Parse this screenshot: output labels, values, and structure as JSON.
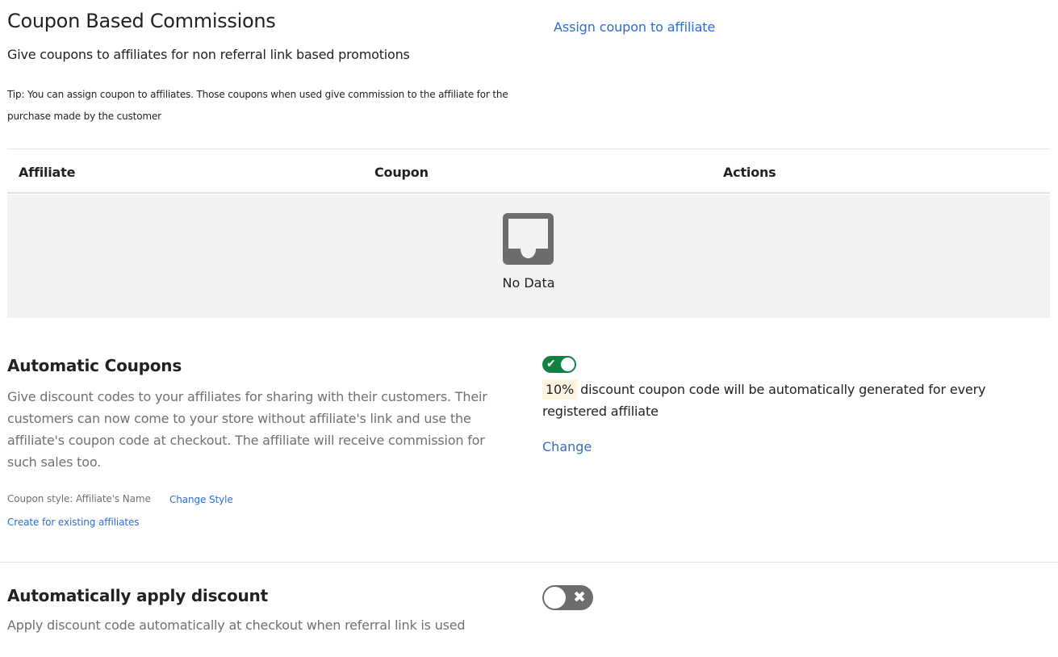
{
  "coupon_commissions": {
    "title": "Coupon Based Commissions",
    "subtitle": "Give coupons to affiliates for non referral link based promotions",
    "tip": "Tip: You can assign coupon to affiliates. Those coupons when used give commission to the affiliate for the purchase made by the customer",
    "assign_link": "Assign coupon to affiliate"
  },
  "table": {
    "columns": [
      "Affiliate",
      "Coupon",
      "Actions"
    ],
    "empty_icon": "inbox-icon",
    "empty_text": "No Data"
  },
  "automatic_coupons": {
    "title": "Automatic Coupons",
    "description": "Give discount codes to your affiliates for sharing with their customers. Their customers can now come to your store without affiliate's link and use the affiliate's coupon code at checkout. The affiliate will receive commission for such sales too.",
    "coupon_style_label": "Coupon style: Affiliate's Name",
    "change_style": "Change Style",
    "create_existing": "Create for existing affiliates",
    "toggle_on": true,
    "toggle_icon": "check-icon",
    "discount_percent": "10%",
    "info_text": "discount coupon code will be automatically generated for every registered affiliate",
    "change_link": "Change"
  },
  "auto_apply": {
    "title": "Automatically apply discount",
    "description": "Apply discount code automatically at checkout when referral link is used",
    "toggle_on": false,
    "toggle_icon": "x-icon"
  },
  "colors": {
    "link": "#2c6ecb",
    "toggle_on": "#108043",
    "toggle_off": "#6d6d6d",
    "empty_bg": "#f2f2f2",
    "badge_bg": "#fdf3e1"
  }
}
